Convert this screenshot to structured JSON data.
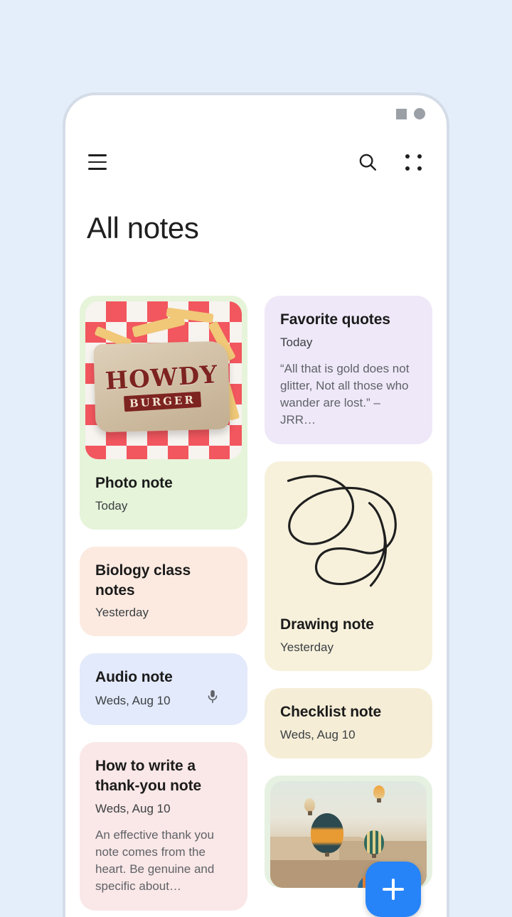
{
  "theme": {
    "page_background": "#e4eefb",
    "phone_frame": "#d4dce7",
    "screen_background": "#ffffff",
    "accent": "#2684f8",
    "text_primary": "#1b1b1b",
    "text_secondary": "#3c4043",
    "text_tertiary": "#5f6368"
  },
  "status_bar": {
    "indicator_square": "square-indicator",
    "indicator_circle": "circle-indicator"
  },
  "app_bar": {
    "menu_icon": "hamburger-menu-icon",
    "search_icon": "search-icon",
    "grid_icon": "grid-view-icon"
  },
  "header": {
    "title": "All notes"
  },
  "fab": {
    "label": "+",
    "icon": "plus-icon",
    "color": "#2684f8"
  },
  "notes": {
    "left_column": [
      {
        "id": "photo-note",
        "title": "Photo note",
        "date": "Today",
        "background": "#e6f4da",
        "media": "photo-burger",
        "media_alt": "Howdy Burger wrapper on red checkered paper with fries",
        "brand_line1": "HOWDY",
        "brand_line2": "BURGER"
      },
      {
        "id": "biology-class-notes",
        "title": "Biology class notes",
        "date": "Yesterday",
        "background": "#fceae1"
      },
      {
        "id": "audio-note",
        "title": "Audio note",
        "date": "Weds, Aug 10",
        "background": "#e3eafb",
        "trailing_icon": "microphone-icon"
      },
      {
        "id": "thank-you-note",
        "title": "How to write a thank-you note",
        "date": "Weds, Aug 10",
        "snippet": "An effective thank you note comes from the heart. Be genuine and specific about…",
        "background": "#fae7e7"
      }
    ],
    "right_column": [
      {
        "id": "favorite-quotes",
        "title": "Favorite quotes",
        "date": "Today",
        "snippet": "“All that is gold does not glitter, Not all those who wander are lost.” – JRR…",
        "background": "#efe8f8"
      },
      {
        "id": "drawing-note",
        "title": "Drawing note",
        "date": "Yesterday",
        "background": "#f7f1dc",
        "media": "drawing-scribble",
        "media_alt": "Hand-drawn looping scribble"
      },
      {
        "id": "checklist-note",
        "title": "Checklist note",
        "date": "Weds, Aug 10",
        "background": "#f5edd6"
      },
      {
        "id": "balloons-note",
        "background": "#e6f1e2",
        "media": "photo-balloons",
        "media_alt": "Hot air balloons over a desert canyon at sunrise"
      }
    ]
  }
}
